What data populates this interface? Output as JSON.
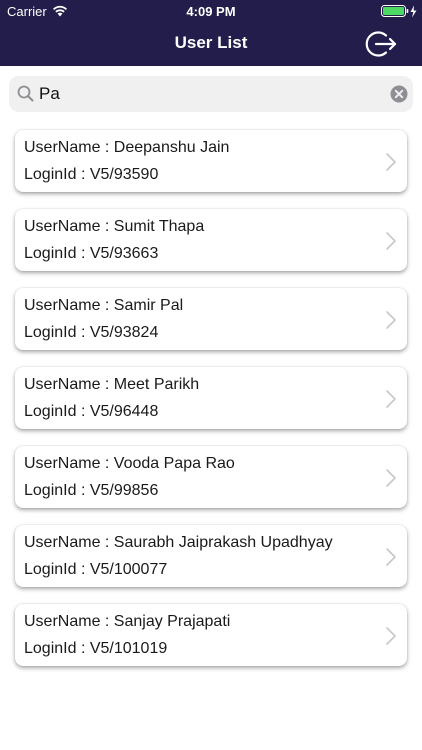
{
  "status_bar": {
    "carrier": "Carrier",
    "time": "4:09 PM",
    "wifi_icon": "wifi-icon",
    "battery_icon": "battery-charging-icon"
  },
  "nav_bar": {
    "title": "User List",
    "logout_icon": "logout-icon",
    "background": "#221d4b"
  },
  "search": {
    "value": "Pa",
    "placeholder": "Search",
    "search_icon": "search-icon",
    "clear_icon": "clear-icon"
  },
  "users": [
    {
      "username_label": "UserName : Deepanshu Jain",
      "loginid_label": "LoginId : V5/93590"
    },
    {
      "username_label": "UserName : Sumit Thapa",
      "loginid_label": "LoginId : V5/93663"
    },
    {
      "username_label": "UserName : Samir Pal",
      "loginid_label": "LoginId : V5/93824"
    },
    {
      "username_label": "UserName : Meet Parikh",
      "loginid_label": "LoginId : V5/96448"
    },
    {
      "username_label": "UserName : Vooda Papa Rao",
      "loginid_label": "LoginId : V5/99856"
    },
    {
      "username_label": "UserName : Saurabh Jaiprakash Upadhyay",
      "loginid_label": "LoginId : V5/100077"
    },
    {
      "username_label": "UserName : Sanjay Prajapati",
      "loginid_label": "LoginId : V5/101019"
    }
  ]
}
